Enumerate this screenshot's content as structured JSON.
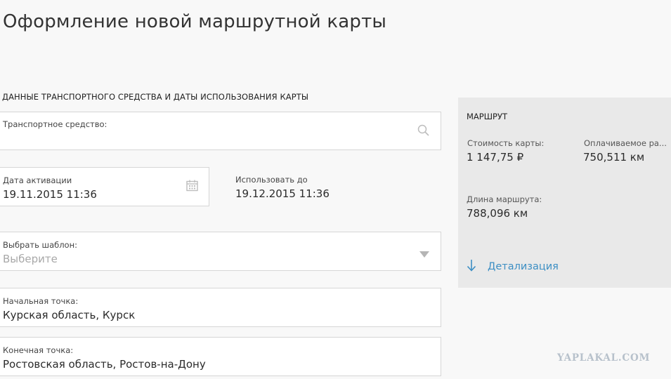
{
  "page": {
    "title": "Оформление новой маршрутной карты",
    "section_title": "ДАННЫЕ ТРАНСПОРТНОГО СРЕДСТВА И ДАТЫ ИСПОЛЬЗОВАНИЯ КАРТЫ"
  },
  "form": {
    "vehicle": {
      "label": "Транспортное средство:",
      "value": "",
      "icon": "search-icon"
    },
    "activation": {
      "label": "Дата активации",
      "value": "19.11.2015 11:36",
      "icon": "calendar-icon"
    },
    "valid_until": {
      "label": "Использовать до",
      "value": "19.12.2015 11:36"
    },
    "template": {
      "label": "Выбрать шаблон:",
      "placeholder": "Выберите",
      "icon": "chevron-down-icon"
    },
    "start_point": {
      "label": "Начальная точка:",
      "value": "Курская область, Курск"
    },
    "end_point": {
      "label": "Конечная точка:",
      "value": "Ростовская область, Ростов-на-Дону"
    }
  },
  "route": {
    "heading": "МАРШРУТ",
    "card_cost_label": "Стоимость карты:",
    "card_cost_value": "1 147,75 ₽",
    "paid_distance_label": "Оплачиваемое ра...",
    "paid_distance_value": "750,511 км",
    "route_length_label": "Длина маршрута:",
    "route_length_value": "788,096 км",
    "details_link": "Детализация",
    "details_icon": "arrow-down-icon"
  },
  "watermark": "YAPLAKAL.COM",
  "colors": {
    "accent": "#3d8fc4",
    "panel": "#e9e9e9",
    "background": "#f8f8f8",
    "border": "#d6d6d6"
  }
}
